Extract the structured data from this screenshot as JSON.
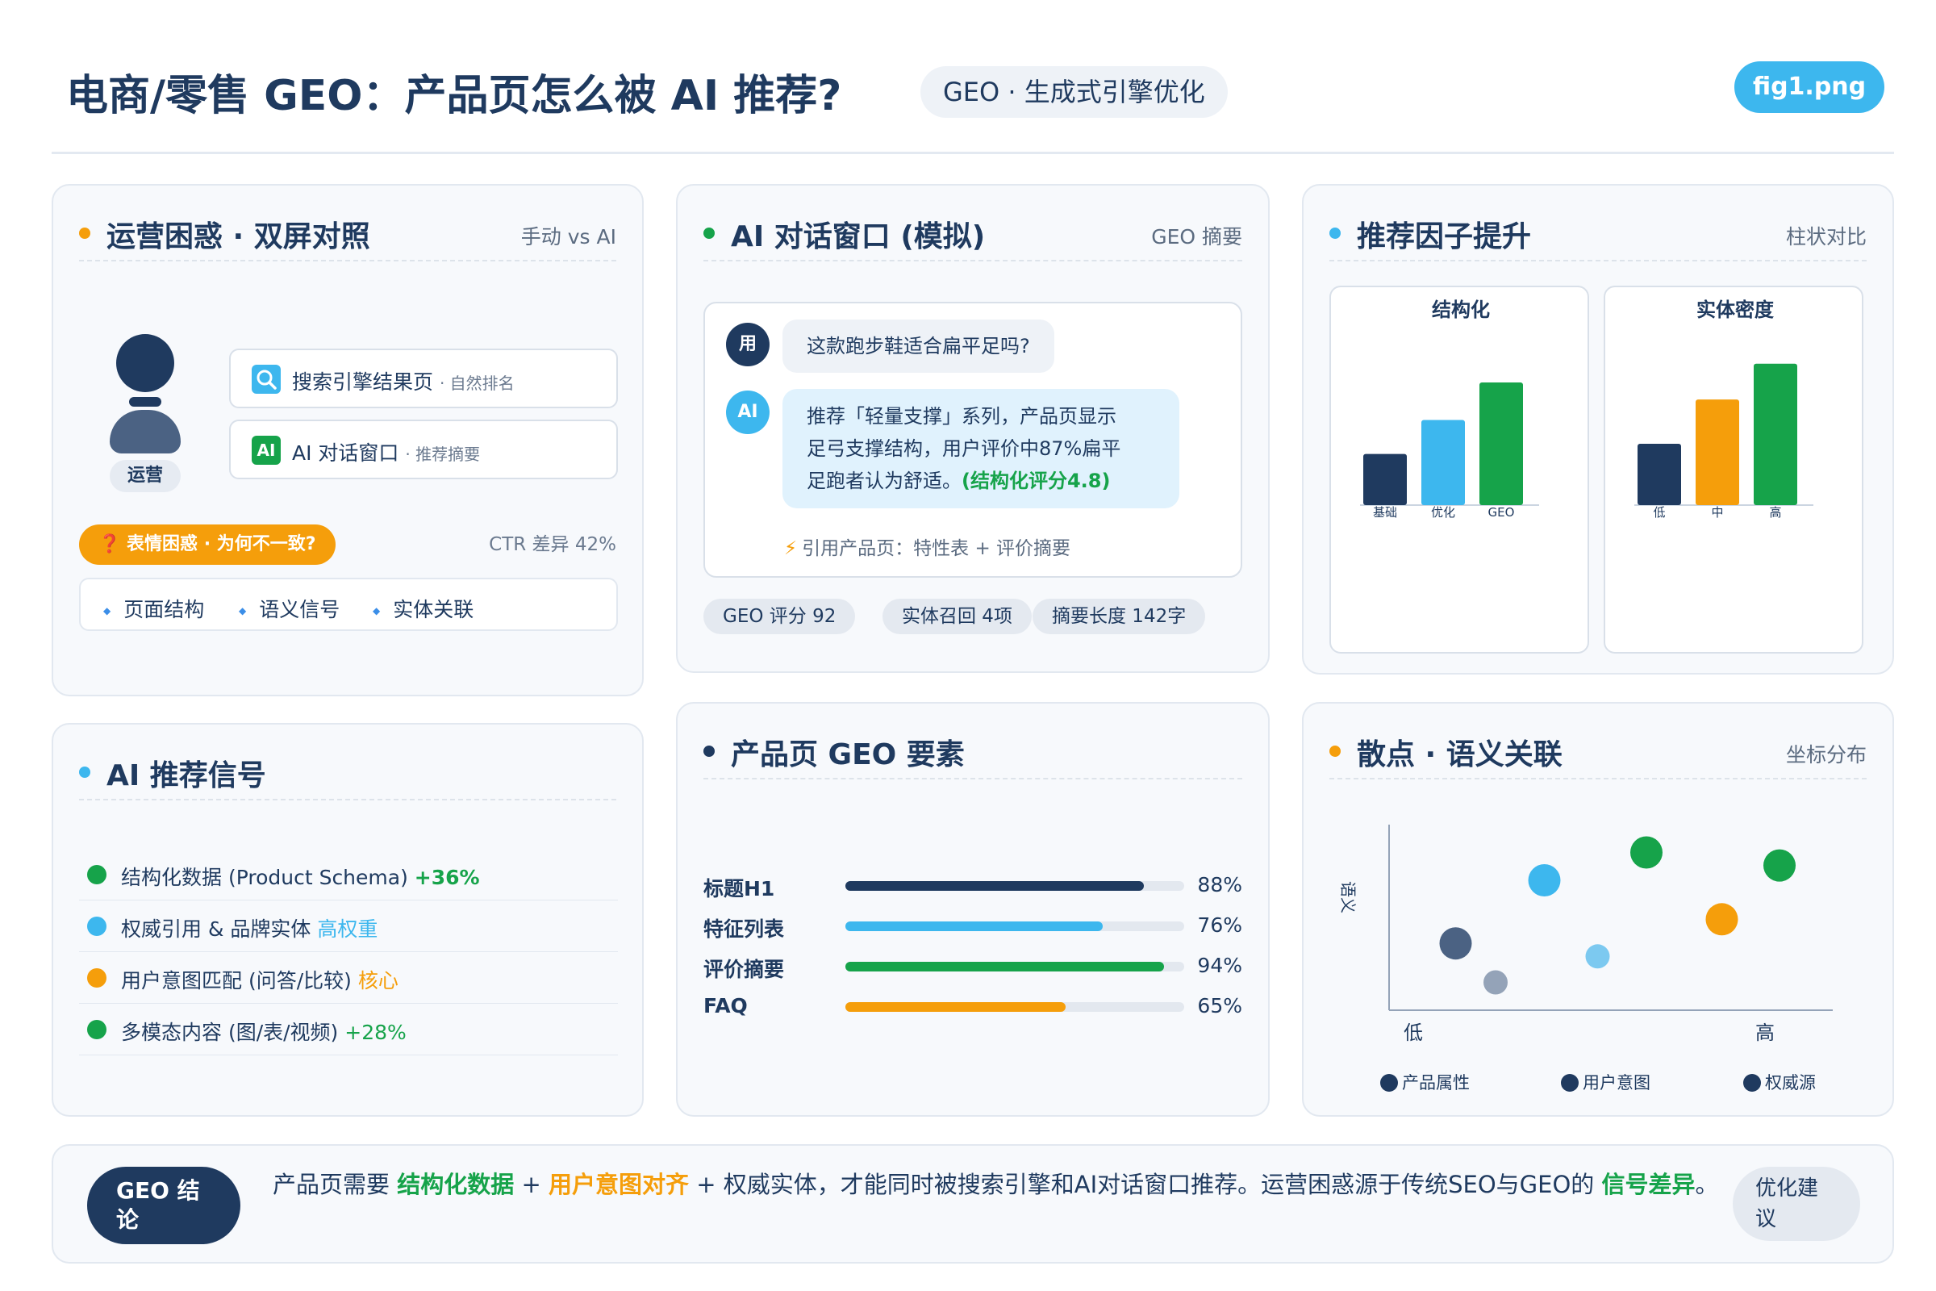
{
  "header": {
    "title": "电商/零售 GEO：产品页怎么被 AI 推荐?",
    "subtitle": "GEO · 生成式引擎优化",
    "file_tag": "fig1.png"
  },
  "colors": {
    "navy": "#1f3a5f",
    "sky": "#3db7ee",
    "green": "#16a34a",
    "orange": "#f59e0b",
    "slate": "#4b6283",
    "gray": "#94a3b8"
  },
  "panel_confusion": {
    "title": "运营困惑 · 双屏对照",
    "tag": "手动 vs AI",
    "role": "运营",
    "screen1": {
      "icon": "search-icon",
      "label": "搜索引擎结果页",
      "note": "· 自然排名"
    },
    "screen2": {
      "icon_text": "AI",
      "label": "AI 对话窗口",
      "note": "· 推荐摘要"
    },
    "warning": "❓ 表情困惑 · 为何不一致?",
    "ctr": "CTR 差异 42%",
    "factors": [
      "页面结构",
      "语义信号",
      "实体关联"
    ]
  },
  "panel_chat": {
    "title": "AI 对话窗口 (模拟)",
    "tag": "GEO 摘要",
    "user_avatar": "用",
    "ai_avatar": "AI",
    "question": "这款跑步鞋适合扁平足吗?",
    "answer_line1": "推荐「轻量支撑」系列，产品页显示",
    "answer_line2": "足弓支撑结构，用户评价中87%扁平",
    "answer_line3": "足跑者认为舒适。",
    "answer_highlight": "(结构化评分4.8)",
    "citation": "引用产品页：特性表 + 评价摘要",
    "metrics": [
      "GEO 评分 92",
      "实体召回 4项",
      "摘要长度 142字"
    ]
  },
  "panel_factors": {
    "title": "推荐因子提升",
    "tag": "柱状对比"
  },
  "panel_signals": {
    "title": "AI 推荐信号",
    "items": [
      {
        "text": "结构化数据 (Product Schema)",
        "badge": "+36%",
        "color": "#16a34a"
      },
      {
        "text": "权威引用 & 品牌实体",
        "badge": "高权重",
        "color": "#3db7ee"
      },
      {
        "text": "用户意图匹配 (问答/比较)",
        "badge": "核心",
        "color": "#f59e0b"
      },
      {
        "text": "多模态内容 (图/表/视频)",
        "badge": "+28%",
        "color": "#16a34a"
      }
    ]
  },
  "panel_elements": {
    "title": "产品页 GEO 要素",
    "items": [
      {
        "label": "标题H1",
        "value": 88,
        "display": "88%",
        "color": "#1f3a5f"
      },
      {
        "label": "特征列表",
        "value": 76,
        "display": "76%",
        "color": "#3db7ee"
      },
      {
        "label": "评价摘要",
        "value": 94,
        "display": "94%",
        "color": "#16a34a"
      },
      {
        "label": "FAQ",
        "value": 65,
        "display": "65%",
        "color": "#f59e0b"
      }
    ]
  },
  "panel_scatter": {
    "title": "散点 · 语义关联",
    "tag": "坐标分布"
  },
  "chart_data": [
    {
      "type": "bar",
      "title": "结构化",
      "categories": [
        "基础",
        "优化",
        "GEO"
      ],
      "values": [
        3,
        5,
        7.2
      ],
      "colors": [
        "#1f3a5f",
        "#3db7ee",
        "#16a34a"
      ]
    },
    {
      "type": "bar",
      "title": "实体密度",
      "categories": [
        "低",
        "中",
        "高"
      ],
      "values": [
        3.6,
        6.2,
        8.3
      ],
      "colors": [
        "#1f3a5f",
        "#f59e0b",
        "#16a34a"
      ]
    },
    {
      "type": "scatter",
      "ylabel": "语义",
      "xtick_labels": [
        "低",
        "高"
      ],
      "xlim": [
        0,
        10
      ],
      "ylim": [
        0,
        10
      ],
      "legend": [
        "产品属性",
        "用户意图",
        "权威源"
      ],
      "legend_placement": "bottom",
      "points": [
        {
          "x": 1.5,
          "y": 3.6,
          "color": "#4b6283",
          "size": "large"
        },
        {
          "x": 2.4,
          "y": 1.5,
          "color": "#94a3b8",
          "size": "small"
        },
        {
          "x": 3.5,
          "y": 7.0,
          "color": "#3db7ee",
          "size": "large"
        },
        {
          "x": 4.7,
          "y": 2.9,
          "color": "#7cc9f0",
          "size": "small"
        },
        {
          "x": 5.8,
          "y": 8.5,
          "color": "#16a34a",
          "size": "large"
        },
        {
          "x": 7.5,
          "y": 4.9,
          "color": "#f59e0b",
          "size": "large"
        },
        {
          "x": 8.8,
          "y": 7.8,
          "color": "#16a34a",
          "size": "large"
        }
      ]
    }
  ],
  "footer": {
    "label": "GEO 结论",
    "text_part1": "产品页需要 ",
    "text_hl1": "结构化数据",
    "text_part2": " + ",
    "text_hl2": "用户意图对齐",
    "text_part3": " + 权威实体，才能同时被搜索引擎和AI对话窗口推荐。运营困惑源于传统SEO与GEO的 ",
    "text_hl3": "信号差异",
    "text_part4": "。",
    "advice": "优化建议"
  }
}
